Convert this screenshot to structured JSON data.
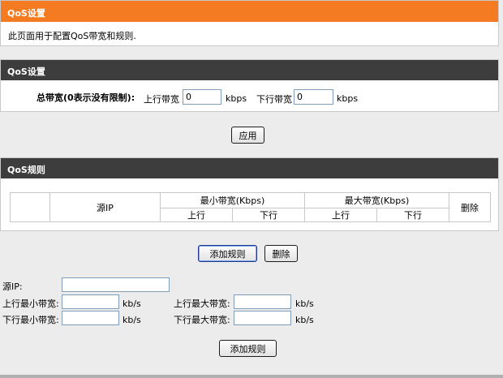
{
  "panel_info": {
    "title": "QoS设置",
    "description": "此页面用于配置QoS带宽和规则."
  },
  "panel_settings": {
    "title": "QoS设置",
    "total_bandwidth_label": "总带宽(0表示没有限制):",
    "upload_label": "上行带宽",
    "upload_value": "0",
    "upload_unit": "kbps",
    "download_label": "下行带宽",
    "download_value": "0",
    "download_unit": "kbps",
    "apply_button": "应用"
  },
  "panel_rules": {
    "title": "QoS规则",
    "columns": {
      "source_ip": "源IP",
      "min_bandwidth": "最小带宽(Kbps)",
      "max_bandwidth": "最大带宽(Kbps)",
      "delete": "删除",
      "up": "上行",
      "down": "下行"
    },
    "add_rule_button": "添加规则",
    "delete_button": "删除"
  },
  "rule_form": {
    "source_ip_label": "源IP:",
    "source_ip_value": "",
    "up_min_label": "上行最小带宽:",
    "up_min_value": "",
    "down_min_label": "下行最小带宽:",
    "down_min_value": "",
    "up_max_label": "上行最大带宽:",
    "up_max_value": "",
    "down_max_label": "下行最大带宽:",
    "down_max_value": "",
    "unit": "kb/s",
    "add_rule_button": "添加规则"
  },
  "colors": {
    "orange_header": "#f47b21",
    "dark_header": "#3d3d3d",
    "background": "#ececec"
  }
}
